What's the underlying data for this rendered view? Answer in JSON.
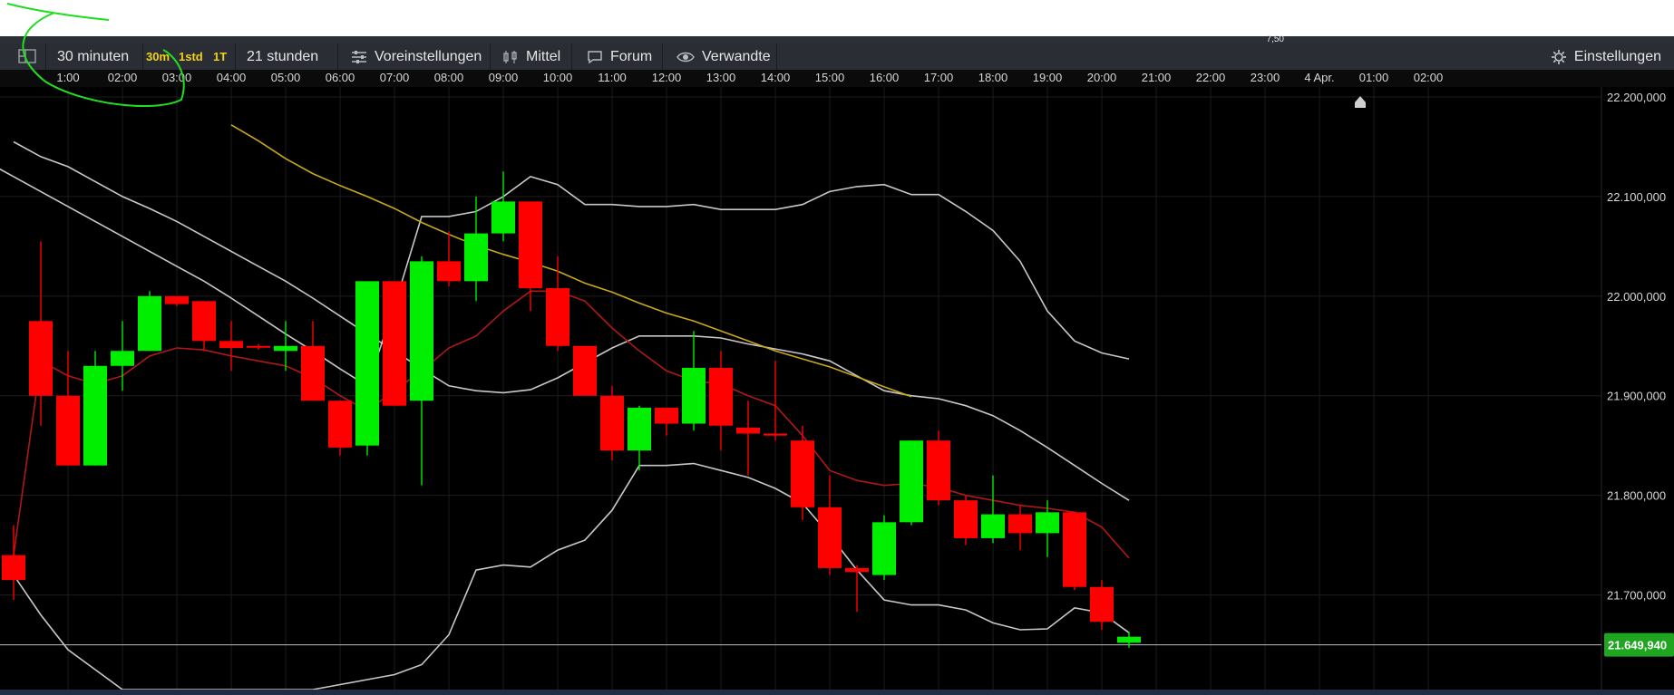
{
  "toolbar": {
    "period": "30 minuten",
    "interval_30m": "30m",
    "interval_1std": "1std",
    "interval_1t": "1T",
    "range": "21 stunden",
    "presets": "Voreinstellungen",
    "average": "Mittel",
    "forum": "Forum",
    "related": "Verwandte",
    "settings": "Einstellungen"
  },
  "top_ticker": "7,50",
  "colors": {
    "up": "#00ee00",
    "down": "#ff0000",
    "ma_red": "#b01818",
    "ma_yellow": "#c9a91a",
    "band": "#c8c8c8",
    "price_badge": "#1fa51f"
  },
  "chart_data": {
    "type": "candlestick",
    "x_tick_labels": [
      "1:00",
      "02:00",
      "03:00",
      "04:00",
      "05:00",
      "06:00",
      "07:00",
      "08:00",
      "09:00",
      "10:00",
      "11:00",
      "12:00",
      "13:00",
      "14:00",
      "15:00",
      "16:00",
      "17:00",
      "18:00",
      "19:00",
      "20:00",
      "21:00",
      "22:00",
      "23:00",
      "4 Apr.",
      "01:00",
      "02:00"
    ],
    "y_tick_labels": [
      "22.200,000",
      "22.100,000",
      "22.000,000",
      "21.900,000",
      "21.800,000",
      "21.700,000"
    ],
    "y_ticks": [
      22200,
      22100,
      22000,
      21900,
      21800,
      21700
    ],
    "ylim": [
      21605,
      22210
    ],
    "last_price": 21649.94,
    "last_price_label": "21.649,940",
    "grid": true,
    "candles": [
      {
        "t": "00:30",
        "o": 21740,
        "h": 21770,
        "l": 21695,
        "c": 21715
      },
      {
        "t": "01:30",
        "o": 21975,
        "h": 22055,
        "l": 21870,
        "c": 21900
      },
      {
        "t": "02:00",
        "o": 21900,
        "h": 21945,
        "l": 21830,
        "c": 21830
      },
      {
        "t": "02:30",
        "o": 21830,
        "h": 21945,
        "l": 21830,
        "c": 21930
      },
      {
        "t": "03:00",
        "o": 21930,
        "h": 21975,
        "l": 21905,
        "c": 21945
      },
      {
        "t": "03:30",
        "o": 21945,
        "h": 22005,
        "l": 21945,
        "c": 22000
      },
      {
        "t": "04:00",
        "o": 22000,
        "h": 22000,
        "l": 21990,
        "c": 21992
      },
      {
        "t": "04:30",
        "o": 21995,
        "h": 21995,
        "l": 21945,
        "c": 21955
      },
      {
        "t": "05:00",
        "o": 21955,
        "h": 21975,
        "l": 21925,
        "c": 21948
      },
      {
        "t": "06:00",
        "o": 21950,
        "h": 21952,
        "l": 21946,
        "c": 21949
      },
      {
        "t": "06:30",
        "o": 21945,
        "h": 21975,
        "l": 21925,
        "c": 21950
      },
      {
        "t": "07:00",
        "o": 21950,
        "h": 21975,
        "l": 21895,
        "c": 21895
      },
      {
        "t": "07:30",
        "o": 21895,
        "h": 21895,
        "l": 21840,
        "c": 21848
      },
      {
        "t": "08:00",
        "o": 21850,
        "h": 22015,
        "l": 21840,
        "c": 22015
      },
      {
        "t": "08:30",
        "o": 22015,
        "h": 22015,
        "l": 21890,
        "c": 21890
      },
      {
        "t": "09:00",
        "o": 21895,
        "h": 22040,
        "l": 21810,
        "c": 22035
      },
      {
        "t": "09:30",
        "o": 22035,
        "h": 22065,
        "l": 22010,
        "c": 22015
      },
      {
        "t": "10:00",
        "o": 22015,
        "h": 22100,
        "l": 21995,
        "c": 22063
      },
      {
        "t": "10:30",
        "o": 22063,
        "h": 22125,
        "l": 22055,
        "c": 22095
      },
      {
        "t": "11:00",
        "o": 22095,
        "h": 22095,
        "l": 21985,
        "c": 22008
      },
      {
        "t": "11:30",
        "o": 22008,
        "h": 22040,
        "l": 21945,
        "c": 21950
      },
      {
        "t": "12:00",
        "o": 21950,
        "h": 21950,
        "l": 21900,
        "c": 21900
      },
      {
        "t": "12:30",
        "o": 21900,
        "h": 21910,
        "l": 21835,
        "c": 21845
      },
      {
        "t": "13:00",
        "o": 21845,
        "h": 21890,
        "l": 21825,
        "c": 21888
      },
      {
        "t": "13:30",
        "o": 21888,
        "h": 21888,
        "l": 21860,
        "c": 21872
      },
      {
        "t": "14:00",
        "o": 21872,
        "h": 21965,
        "l": 21865,
        "c": 21928
      },
      {
        "t": "14:30",
        "o": 21928,
        "h": 21945,
        "l": 21845,
        "c": 21870
      },
      {
        "t": "15:00",
        "o": 21868,
        "h": 21895,
        "l": 21820,
        "c": 21862
      },
      {
        "t": "15:30",
        "o": 21862,
        "h": 21935,
        "l": 21855,
        "c": 21860
      },
      {
        "t": "16:00",
        "o": 21855,
        "h": 21870,
        "l": 21775,
        "c": 21788
      },
      {
        "t": "16:30",
        "o": 21788,
        "h": 21820,
        "l": 21720,
        "c": 21727
      },
      {
        "t": "17:00",
        "o": 21727,
        "h": 21730,
        "l": 21683,
        "c": 21723
      },
      {
        "t": "17:30",
        "o": 21720,
        "h": 21780,
        "l": 21715,
        "c": 21773
      },
      {
        "t": "18:00",
        "o": 21773,
        "h": 21855,
        "l": 21770,
        "c": 21855
      },
      {
        "t": "18:30",
        "o": 21855,
        "h": 21865,
        "l": 21790,
        "c": 21795
      },
      {
        "t": "19:00",
        "o": 21795,
        "h": 21800,
        "l": 21750,
        "c": 21757
      },
      {
        "t": "19:30",
        "o": 21757,
        "h": 21820,
        "l": 21752,
        "c": 21781
      },
      {
        "t": "20:00",
        "o": 21781,
        "h": 21790,
        "l": 21745,
        "c": 21762
      },
      {
        "t": "20:30",
        "o": 21762,
        "h": 21795,
        "l": 21738,
        "c": 21783
      },
      {
        "t": "21:00",
        "o": 21783,
        "h": 21783,
        "l": 21705,
        "c": 21708
      },
      {
        "t": "21:30",
        "o": 21708,
        "h": 21715,
        "l": 21665,
        "c": 21673
      },
      {
        "t": "22:00",
        "o": 21652,
        "h": 21663,
        "l": 21647,
        "c": 21658
      }
    ],
    "ma_short": [
      21740,
      21935,
      21920,
      21912,
      21920,
      21940,
      21948,
      21946,
      21940,
      21935,
      21930,
      21918,
      21900,
      21885,
      21905,
      21925,
      21948,
      21960,
      21985,
      22005,
      22005,
      21995,
      21968,
      21945,
      21925,
      21915,
      21912,
      21900,
      21890,
      21860,
      21825,
      21815,
      21810,
      21812,
      21808,
      21800,
      21795,
      21790,
      21787,
      21783,
      21768,
      21737
    ],
    "ma_long": [
      21950,
      21950,
      21950,
      21950,
      21950,
      21950,
      21950,
      21950,
      21950,
      21950,
      21950,
      22172,
      22156,
      22138,
      22123,
      22111,
      22100,
      22088,
      22074,
      22062,
      22051,
      22042,
      22034,
      22025,
      22013,
      22004,
      21993,
      21983,
      21975,
      21965,
      21955,
      21945,
      21937,
      21929,
      21919,
      21909,
      21899
    ],
    "ma_long_start_t": "04:00",
    "band_upper": [
      22160,
      22145,
      22135,
      22120,
      22105,
      22090,
      22075,
      22060,
      22045,
      22030,
      22015,
      21998,
      21980,
      21962,
      21945,
      21927,
      21910,
      21990,
      22080,
      22080,
      22085,
      22100,
      22120,
      22112,
      22092,
      22092,
      22090,
      22090,
      22092,
      22087,
      22087,
      22087,
      22092,
      22105,
      22110,
      22112,
      22102,
      22102,
      22085,
      22066,
      22035,
      21985,
      21955,
      21943,
      21937
    ],
    "band_mid": [
      22155,
      22140,
      22130,
      22115,
      22100,
      22088,
      22075,
      22060,
      22045,
      22030,
      22015,
      21998,
      21980,
      21962,
      21945,
      21927,
      21910,
      21905,
      21903,
      21906,
      21918,
      21933,
      21948,
      21960,
      21960,
      21960,
      21958,
      21952,
      21947,
      21942,
      21935,
      21920,
      21905,
      21900,
      21897,
      21890,
      21880,
      21865,
      21848,
      21830,
      21812,
      21795
    ],
    "band_lower": [
      21720,
      21680,
      21645,
      21625,
      21605,
      21605,
      21605,
      21605,
      21605,
      21605,
      21605,
      21605,
      21610,
      21615,
      21620,
      21630,
      21660,
      21725,
      21730,
      21728,
      21745,
      21755,
      21785,
      21830,
      21830,
      21832,
      21825,
      21818,
      21807,
      21792,
      21760,
      21725,
      21695,
      21690,
      21690,
      21685,
      21672,
      21665,
      21666,
      21687,
      21682,
      21662
    ]
  }
}
